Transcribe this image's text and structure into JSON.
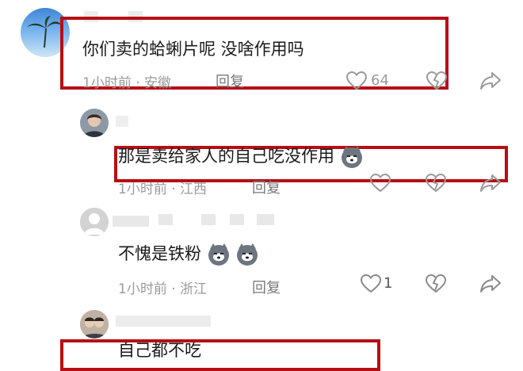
{
  "comments": [
    {
      "text": "你们卖的蛤蜊片呢  没啥作用吗",
      "time": "1小时前 · 安徽",
      "reply": "回复",
      "likes": "64",
      "avatar": "palm-tree-avatar"
    },
    {
      "text": "那是卖给家人的自己吃没作用",
      "time": "1小时前 · 江西",
      "reply": "回复",
      "likes": ""
    },
    {
      "text": "不愧是铁粉",
      "time": "1小时前 · 浙江",
      "reply": "回复",
      "likes": "1"
    },
    {
      "text": "自己都不吃",
      "time": "",
      "reply": "",
      "likes": ""
    }
  ],
  "icons": {
    "like": "heart-outline-icon",
    "dislike": "broken-heart-icon",
    "share": "share-arrow-icon",
    "emoji": "husky-dog-emoji"
  },
  "colors": {
    "highlight_box": "#b50f14",
    "meta_text": "#9a9a9a"
  }
}
